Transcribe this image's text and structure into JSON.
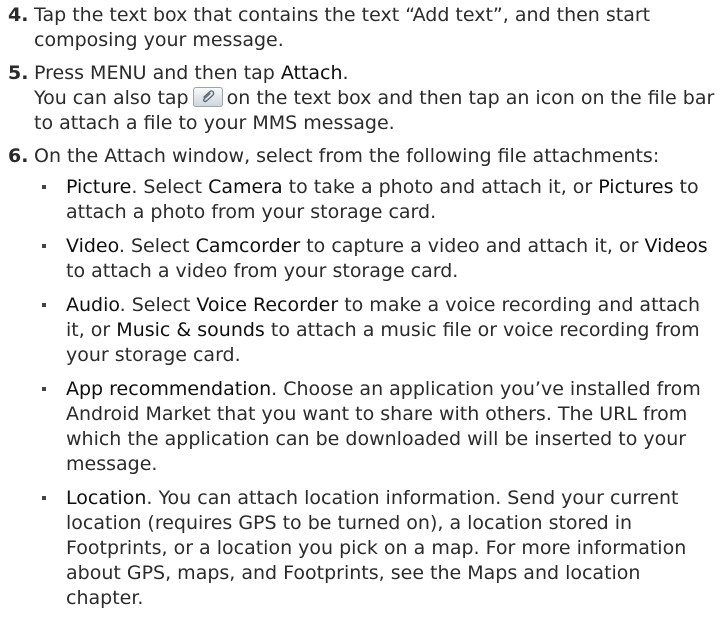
{
  "steps": [
    {
      "num": "4.",
      "text": "Tap the text box that contains the text “Add text”, and then start composing your message."
    },
    {
      "num": "5.",
      "line1_pre": "Press MENU and then tap ",
      "line1_kw": "Attach",
      "line1_post": ".",
      "line2_pre": "You can also tap",
      "line2_post": "on the text box and then tap an icon on the file bar to attach a file to your MMS message.",
      "icon": "paperclip-attach-icon"
    },
    {
      "num": "6.",
      "text": "On the Attach window, select from the following file attachments:",
      "options": [
        {
          "head": "Picture",
          "t1": ". Select ",
          "k1": "Camera",
          "t2": " to take a photo and attach it, or ",
          "k2": "Pictures",
          "t3": " to attach a photo from your storage card."
        },
        {
          "head": "Video",
          "t1": ". Select ",
          "k1": "Camcorder",
          "t2": " to capture a video and attach it, or ",
          "k2": "Videos",
          "t3": " to attach a video from your storage card."
        },
        {
          "head": "Audio",
          "t1": ". Select ",
          "k1": "Voice Recorder",
          "t2": " to make a voice recording and attach it, or ",
          "k2": "Music & sounds",
          "t3": " to attach a music file or voice recording from your storage card."
        },
        {
          "head": "App recommendation",
          "t1": ". Choose an application you’ve installed from Android Market that you want to share with others. The URL from which the application can be downloaded will be inserted to your message.",
          "k1": "",
          "t2": "",
          "k2": "",
          "t3": ""
        },
        {
          "head": "Location",
          "t1": ". You can attach location information. Send your current location (requires GPS to be turned on), a location stored in Footprints, or a location you pick on a map. For more information about GPS, maps, and Footprints, see the Maps and location chapter.",
          "k1": "",
          "t2": "",
          "k2": "",
          "t3": ""
        }
      ]
    }
  ]
}
